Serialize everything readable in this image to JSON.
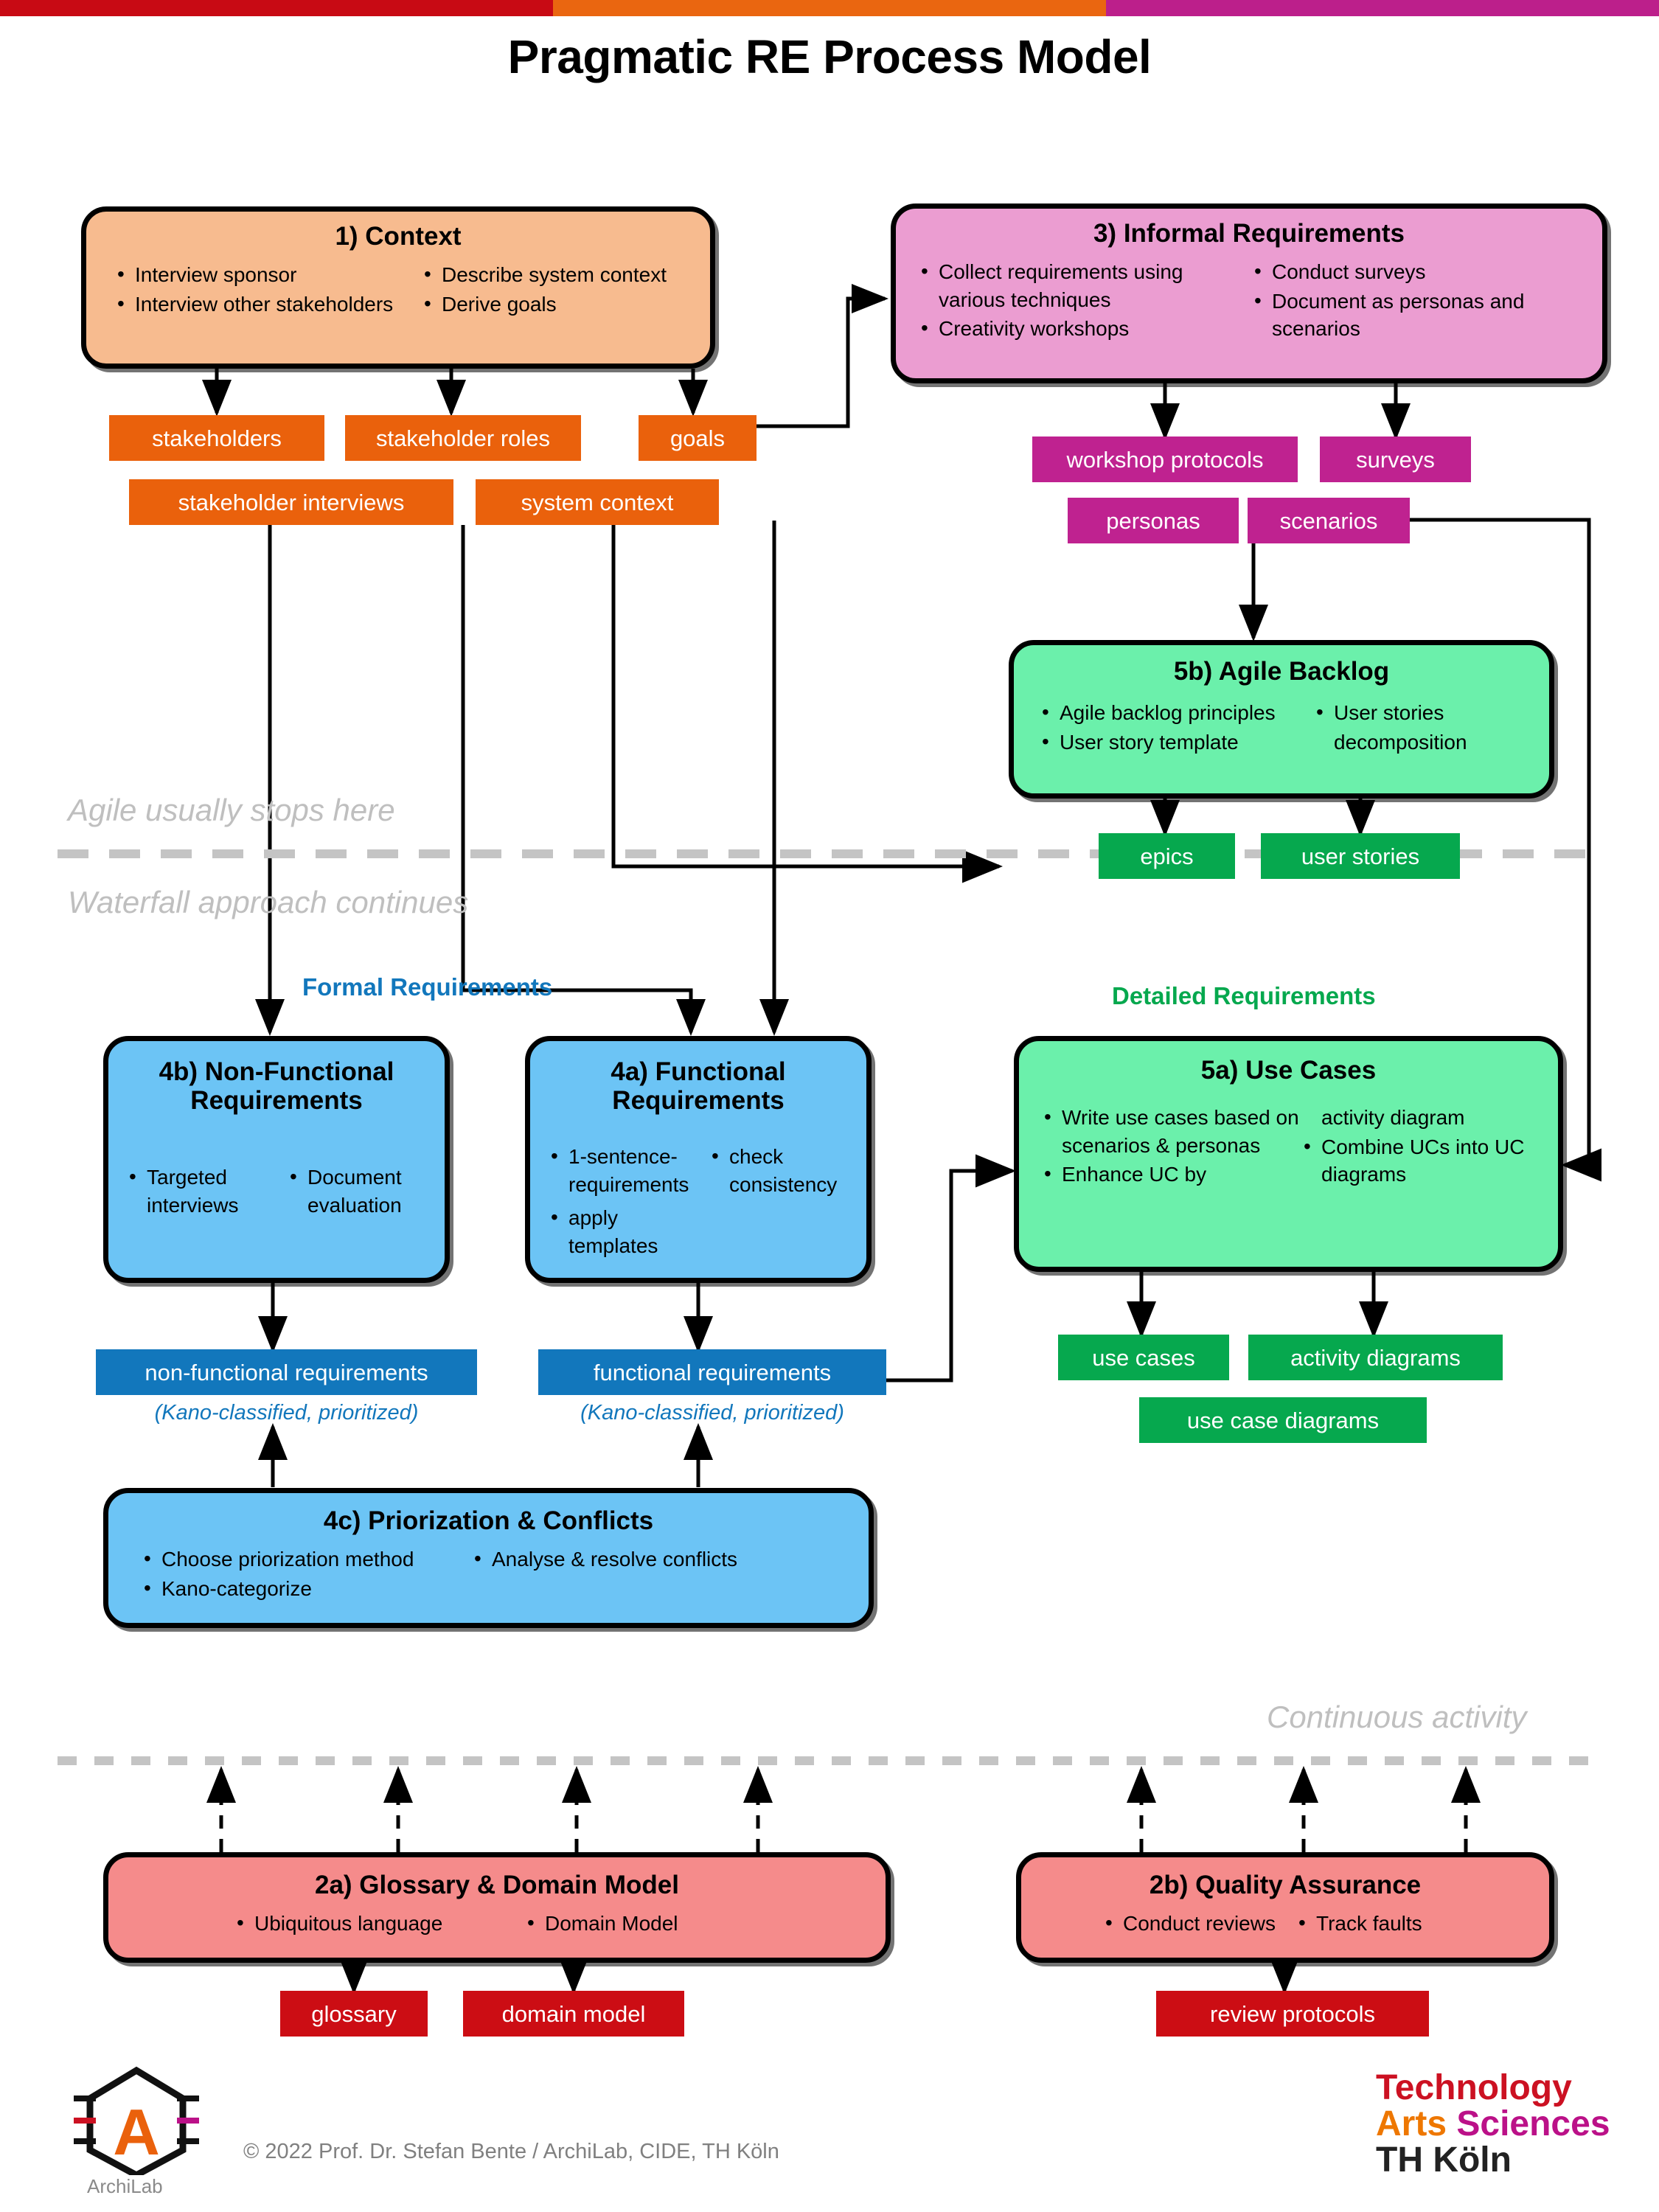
{
  "page": {
    "title": "Pragmatic RE Process Model",
    "topbar_colors": [
      "#c80a14",
      "#ea6610",
      "#bc1f8b"
    ]
  },
  "colors": {
    "context_fill": "#f7bb8f",
    "context_artifact": "#ea610c",
    "informal_fill": "#eb9dd1",
    "informal_artifact": "#bf2290",
    "formal_fill": "#6cc4f5",
    "formal_artifact": "#1277bc",
    "detailed_fill": "#6bf0ab",
    "detailed_artifact": "#06a84e",
    "continuous_fill": "#f58b8b",
    "continuous_artifact": "#cc0d14",
    "annotation_grey": "#bfbfbf",
    "formal_caption": "#1277bc",
    "detailed_caption": "#06a84e"
  },
  "activities": [
    {
      "id": "context",
      "title": "1) Context",
      "left_bullets": [
        "Interview sponsor",
        "Interview other stakeholders"
      ],
      "right_bullets": [
        "Describe system context",
        "Derive goals"
      ]
    },
    {
      "id": "informal",
      "title": "3) Informal Requirements",
      "left_bullets": [
        "Collect requirements using various techniques",
        "Creativity workshops"
      ],
      "right_bullets": [
        "Conduct surveys",
        "Document as personas and scenarios"
      ]
    },
    {
      "id": "agile-backlog",
      "title": "5b) Agile Backlog",
      "left_bullets": [
        "Agile backlog principles",
        "User story template"
      ],
      "right_bullets": [
        "User stories",
        "decomposition"
      ]
    },
    {
      "id": "nonfunctional",
      "title": "4b) Non-Functional Requirements",
      "left_bullets": [
        "Targeted interviews"
      ],
      "right_bullets": [
        "Document evaluation"
      ]
    },
    {
      "id": "functional",
      "title": "4a) Functional Requirements",
      "left_bullets": [
        "1-sentence-requirements",
        "apply templates"
      ],
      "right_bullets": [
        "check consistency"
      ]
    },
    {
      "id": "usecases",
      "title": "5a) Use Cases",
      "left_bullets": [
        "Write use cases based on scenarios & personas",
        "Enhance UC by"
      ],
      "right_bullets": [
        "activity diagram",
        "Combine UCs into UC diagrams"
      ]
    },
    {
      "id": "prioritization",
      "title": "4c) Priorization & Conflicts",
      "left_bullets": [
        "Choose priorization method",
        "Kano-categorize"
      ],
      "right_bullets": [
        "Analyse & resolve conflicts"
      ]
    },
    {
      "id": "glossary",
      "title": "2a) Glossary & Domain Model",
      "left_bullets": [
        "Ubiquitous language"
      ],
      "right_bullets": [
        "Domain Model"
      ]
    },
    {
      "id": "qa",
      "title": "2b) Quality Assurance",
      "left_bullets": [
        "Conduct reviews"
      ],
      "right_bullets": [
        "Track faults"
      ]
    }
  ],
  "artifacts": {
    "stakeholders": "stakeholders",
    "stakeholder_roles": "stakeholder roles",
    "goals": "goals",
    "stakeholder_interviews": "stakeholder interviews",
    "system_context": "system context",
    "workshop_protocols": "workshop protocols",
    "surveys": "surveys",
    "personas": "personas",
    "scenarios": "scenarios",
    "epics": "epics",
    "user_stories": "user stories",
    "non_functional_requirements": "non-functional requirements",
    "functional_requirements": "functional requirements",
    "use_cases": "use cases",
    "activity_diagrams": "activity diagrams",
    "use_case_diagrams": "use case diagrams",
    "glossary": "glossary",
    "domain_model": "domain model",
    "review_protocols": "review protocols"
  },
  "sublabels": {
    "nfr_kano": "(Kano-classified, prioritized)",
    "fr_kano": "(Kano-classified, prioritized)"
  },
  "annotations": {
    "agile_stops": "Agile usually stops here",
    "waterfall_continues": "Waterfall approach continues",
    "continuous_activity": "Continuous activity"
  },
  "captions": {
    "formal_requirements": "Formal Requirements",
    "detailed_requirements": "Detailed Requirements"
  },
  "footer": {
    "copyright": "© 2022 Prof. Dr. Stefan Bente / ArchiLab, CIDE, TH Köln",
    "archilab_mark": "A",
    "archilab_label": "ArchiLab",
    "thk_line1": "Technology",
    "thk_line2_a": "Arts ",
    "thk_line2_b": "Sciences",
    "thk_line3": "TH Köln"
  }
}
